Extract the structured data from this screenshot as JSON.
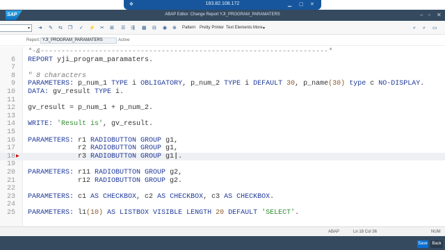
{
  "remote_bar": {
    "ip": "183.82.108.172"
  },
  "window": {
    "logo": "SAP",
    "title": "ABAP Editor: Change Report YJI_PROGRAM_PARAMATERS"
  },
  "toolbar": {
    "buttons": [
      "Pattern",
      "Pretty Printer",
      "Text Elements",
      "More"
    ],
    "more_icon": "chevron-down-icon"
  },
  "info": {
    "report_label": "Report:",
    "report_name": "YJI_PROGRAM_PARAMATERS",
    "status": "Active"
  },
  "editor": {
    "current_line": "18",
    "lines": [
      {
        "n": "",
        "parts": [
          {
            "t": "cm",
            "v": "*-&---------------------------------------------------------------------*"
          }
        ]
      },
      {
        "n": "6",
        "parts": [
          {
            "t": "kw",
            "v": "REPORT "
          },
          {
            "t": "id",
            "v": "yji_program_paramaters."
          }
        ]
      },
      {
        "n": "7",
        "parts": []
      },
      {
        "n": "8",
        "parts": [
          {
            "t": "cm",
            "v": "\" 8 characters"
          }
        ]
      },
      {
        "n": "9",
        "parts": [
          {
            "t": "kw",
            "v": "PARAMETERS: "
          },
          {
            "t": "id",
            "v": "p_num_1 "
          },
          {
            "t": "kw",
            "v": "TYPE "
          },
          {
            "t": "id",
            "v": "i "
          },
          {
            "t": "kw",
            "v": "OBLIGATORY"
          },
          {
            "t": "id",
            "v": ", p_num_2 "
          },
          {
            "t": "kw",
            "v": "TYPE "
          },
          {
            "t": "id",
            "v": "i "
          },
          {
            "t": "kw",
            "v": "DEFAULT "
          },
          {
            "t": "num",
            "v": "30"
          },
          {
            "t": "id",
            "v": ", p_name"
          },
          {
            "t": "num",
            "v": "(30) "
          },
          {
            "t": "kw",
            "v": "type "
          },
          {
            "t": "id",
            "v": "c "
          },
          {
            "t": "kw",
            "v": "NO-DISPLAY"
          },
          {
            "t": "id",
            "v": "."
          }
        ]
      },
      {
        "n": "10",
        "parts": [
          {
            "t": "kw",
            "v": "DATA: "
          },
          {
            "t": "id",
            "v": "gv_result "
          },
          {
            "t": "kw",
            "v": "TYPE "
          },
          {
            "t": "id",
            "v": "i."
          }
        ]
      },
      {
        "n": "11",
        "parts": []
      },
      {
        "n": "12",
        "parts": [
          {
            "t": "id",
            "v": "gv_result = p_num_1 + p_num_2."
          }
        ]
      },
      {
        "n": "13",
        "parts": []
      },
      {
        "n": "14",
        "parts": [
          {
            "t": "kw",
            "v": "WRITE: "
          },
          {
            "t": "str",
            "v": "'Result is'"
          },
          {
            "t": "id",
            "v": ", gv_result."
          }
        ]
      },
      {
        "n": "15",
        "parts": []
      },
      {
        "n": "16",
        "parts": [
          {
            "t": "kw",
            "v": "PARAMETERS: "
          },
          {
            "t": "id",
            "v": "r1 "
          },
          {
            "t": "kw",
            "v": "RADIOBUTTON GROUP "
          },
          {
            "t": "id",
            "v": "g1,"
          }
        ]
      },
      {
        "n": "17",
        "parts": [
          {
            "t": "id",
            "v": "            r2 "
          },
          {
            "t": "kw",
            "v": "RADIOBUTTON GROUP "
          },
          {
            "t": "id",
            "v": "g1,"
          }
        ]
      },
      {
        "n": "18",
        "parts": [
          {
            "t": "id",
            "v": "            r3 "
          },
          {
            "t": "kw",
            "v": "RADIOBUTTON GROUP "
          },
          {
            "t": "id",
            "v": "g1"
          },
          {
            "t": "caret",
            "v": "|"
          },
          {
            "t": "id",
            "v": "."
          }
        ]
      },
      {
        "n": "19",
        "parts": []
      },
      {
        "n": "20",
        "parts": [
          {
            "t": "kw",
            "v": "PARAMETERS: "
          },
          {
            "t": "id",
            "v": "r11 "
          },
          {
            "t": "kw",
            "v": "RADIOBUTTON GROUP "
          },
          {
            "t": "id",
            "v": "g2,"
          }
        ]
      },
      {
        "n": "21",
        "parts": [
          {
            "t": "id",
            "v": "            r12 "
          },
          {
            "t": "kw",
            "v": "RADIOBUTTON GROUP "
          },
          {
            "t": "id",
            "v": "g2."
          }
        ]
      },
      {
        "n": "22",
        "parts": []
      },
      {
        "n": "23",
        "parts": [
          {
            "t": "kw",
            "v": "PARAMETERS: "
          },
          {
            "t": "id",
            "v": "c1 "
          },
          {
            "t": "kw",
            "v": "AS CHECKBOX"
          },
          {
            "t": "id",
            "v": ", c2 "
          },
          {
            "t": "kw",
            "v": "AS CHECKBOX"
          },
          {
            "t": "id",
            "v": ", c3 "
          },
          {
            "t": "kw",
            "v": "AS CHECKBOX"
          },
          {
            "t": "id",
            "v": "."
          }
        ]
      },
      {
        "n": "24",
        "parts": []
      },
      {
        "n": "25",
        "parts": [
          {
            "t": "kw",
            "v": "PARAMETERS: "
          },
          {
            "t": "id",
            "v": "l1"
          },
          {
            "t": "num",
            "v": "(10) "
          },
          {
            "t": "kw",
            "v": "AS LISTBOX VISIBLE LENGTH "
          },
          {
            "t": "num",
            "v": "20 "
          },
          {
            "t": "kw",
            "v": "DEFAULT "
          },
          {
            "t": "str",
            "v": "'SELECT'"
          },
          {
            "t": "id",
            "v": "."
          }
        ]
      }
    ]
  },
  "status_bar": {
    "language": "ABAP",
    "position": "Ln 18 Col 36",
    "mode": "NUM"
  },
  "footer": {
    "save_label": "Save",
    "back_label": "Back"
  },
  "colors": {
    "shell": "#354a5f",
    "keyword": "#1f3a9a",
    "string": "#2e8b2e",
    "number": "#8a5a2b",
    "comment": "#7c7c7c",
    "accent": "#0a6ed1"
  }
}
